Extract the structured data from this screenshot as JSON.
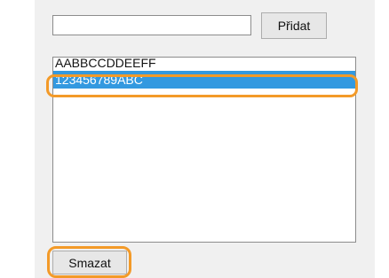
{
  "form": {
    "input_value": "",
    "add_label": "Přidat",
    "delete_label": "Smazat"
  },
  "list": {
    "items": [
      {
        "label": "AABBCCDDEEFF",
        "selected": false
      },
      {
        "label": "123456789ABC",
        "selected": true
      }
    ]
  },
  "colors": {
    "panel_background": "#f0f0f0",
    "selection": "#3399e0",
    "highlight": "#f39a28"
  }
}
